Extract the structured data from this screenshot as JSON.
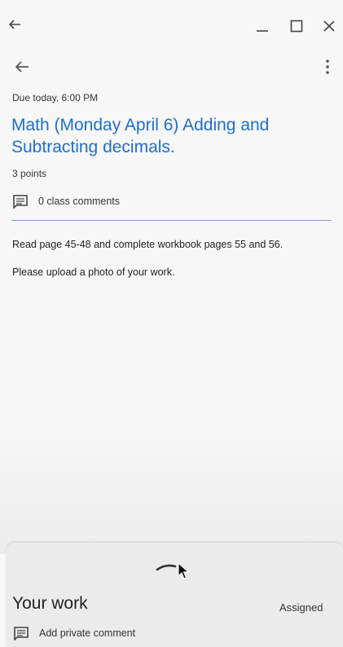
{
  "window": {
    "back_icon": "back-arrow-icon",
    "minimize_icon": "minimize-icon",
    "maximize_icon": "maximize-icon",
    "close_icon": "close-icon"
  },
  "app_bar": {
    "back_icon": "back-arrow-icon",
    "menu_icon": "more-vert-icon"
  },
  "assignment": {
    "due": "Due today, 6:00 PM",
    "title": "Math (Monday April 6) Adding and Subtracting decimals.",
    "points": "3 points",
    "class_comments": "0 class comments",
    "description": [
      "Read page 45-48 and complete workbook pages 55 and 56.",
      "Please upload a photo of your work."
    ]
  },
  "your_work": {
    "title": "Your work",
    "status": "Assigned",
    "private_comment": "Add private comment"
  },
  "colors": {
    "title": "#1f6fcf",
    "divider": "#7aa4d6"
  }
}
